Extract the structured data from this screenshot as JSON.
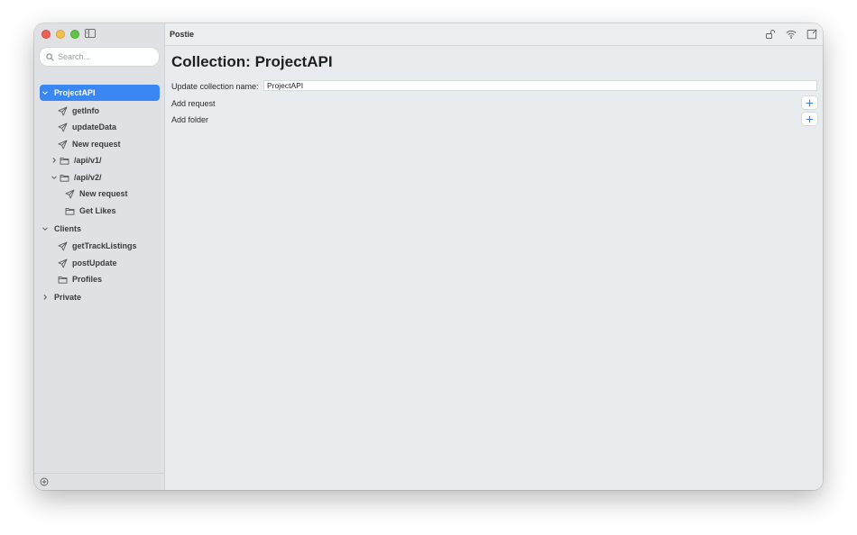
{
  "app": {
    "title": "Postie"
  },
  "search": {
    "placeholder": "Search..."
  },
  "sidebar": {
    "tree": [
      {
        "label": "ProjectAPI",
        "type": "collection",
        "expanded": true,
        "selected": true
      },
      {
        "label": "getInfo",
        "type": "request"
      },
      {
        "label": "updateData",
        "type": "request"
      },
      {
        "label": "New request",
        "type": "request"
      },
      {
        "label": "/api/v1/",
        "type": "folder",
        "expanded": false
      },
      {
        "label": "/api/v2/",
        "type": "folder",
        "expanded": true
      },
      {
        "label": "New request",
        "type": "request"
      },
      {
        "label": "Get Likes",
        "type": "folder"
      },
      {
        "label": "Clients",
        "type": "collection",
        "expanded": true
      },
      {
        "label": "getTrackListings",
        "type": "request"
      },
      {
        "label": "postUpdate",
        "type": "request"
      },
      {
        "label": "Profiles",
        "type": "folder"
      },
      {
        "label": "Private",
        "type": "collection",
        "expanded": false
      }
    ]
  },
  "main": {
    "heading_prefix": "Collection:",
    "heading_name": "ProjectAPI",
    "update_label": "Update collection name:",
    "name_value": "ProjectAPI",
    "add_request_label": "Add request",
    "add_folder_label": "Add folder"
  },
  "colors": {
    "accent": "#3a86f2",
    "sidebar_bg": "#dfe1e4",
    "content_bg": "#e9ecef"
  }
}
